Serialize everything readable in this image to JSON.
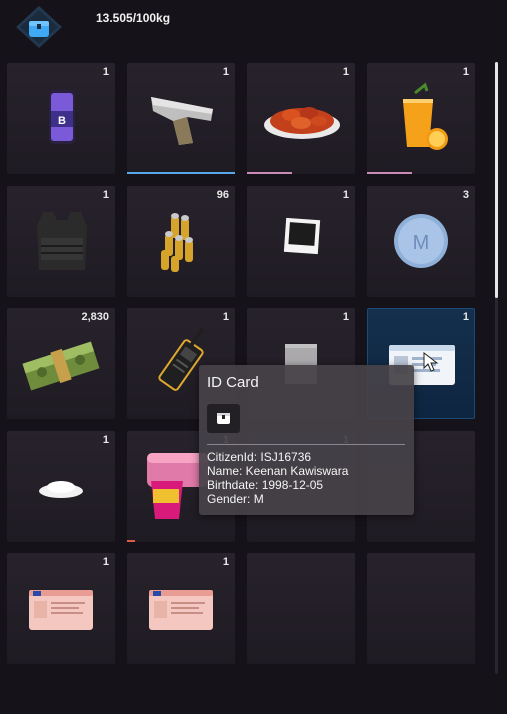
{
  "header": {
    "weight_text": "13.505/100kg",
    "icon": "inventory-bag-icon",
    "accent": "#3fa9f5"
  },
  "slots": [
    {
      "item": "phone",
      "icon": "phone-icon",
      "count": "1"
    },
    {
      "item": "pistol",
      "icon": "pistol-icon",
      "count": "1",
      "durability": 1.0,
      "bar_color": "#56a8e8"
    },
    {
      "item": "chicken-wings",
      "icon": "chicken-wings-icon",
      "count": "1",
      "durability": 0.42,
      "bar_color": "#c98bb6"
    },
    {
      "item": "orange-juice",
      "icon": "orange-juice-icon",
      "count": "1",
      "durability": 0.42,
      "bar_color": "#c98bb6"
    },
    {
      "item": "armor-vest",
      "icon": "armor-vest-icon",
      "count": "1"
    },
    {
      "item": "ammo",
      "icon": "ammo-icon",
      "count": "96"
    },
    {
      "item": "photo",
      "icon": "photo-icon",
      "count": "1"
    },
    {
      "item": "pill",
      "icon": "pill-icon",
      "count": "3"
    },
    {
      "item": "money",
      "icon": "money-icon",
      "count": "2,830"
    },
    {
      "item": "radio",
      "icon": "radio-icon",
      "count": "1"
    },
    {
      "item": "baggie",
      "icon": "baggie-icon",
      "count": "1"
    },
    {
      "item": "id-card",
      "icon": "id-card-icon",
      "count": "1",
      "selected": true
    },
    {
      "item": "powder",
      "icon": "powder-icon",
      "count": "1"
    },
    {
      "item": "drink",
      "icon": "drink-icon",
      "count": "1",
      "durability": 0.07,
      "bar_color": "#e05a4a"
    },
    {
      "item": "unknown",
      "icon": "item-icon",
      "count": "1"
    },
    {
      "item": "empty",
      "icon": "",
      "count": ""
    },
    {
      "item": "license",
      "icon": "license-card-icon",
      "count": "1"
    },
    {
      "item": "license",
      "icon": "license-card-icon",
      "count": "1"
    },
    {
      "item": "empty",
      "icon": "",
      "count": ""
    },
    {
      "item": "empty",
      "icon": "",
      "count": ""
    }
  ],
  "tooltip": {
    "title": "ID Card",
    "icon": "bag-icon",
    "lines": [
      "CitizenId: ISJ16736",
      "Name: Keenan Kawiswara",
      "Birthdate: 1998-12-05",
      "Gender: M"
    ]
  }
}
